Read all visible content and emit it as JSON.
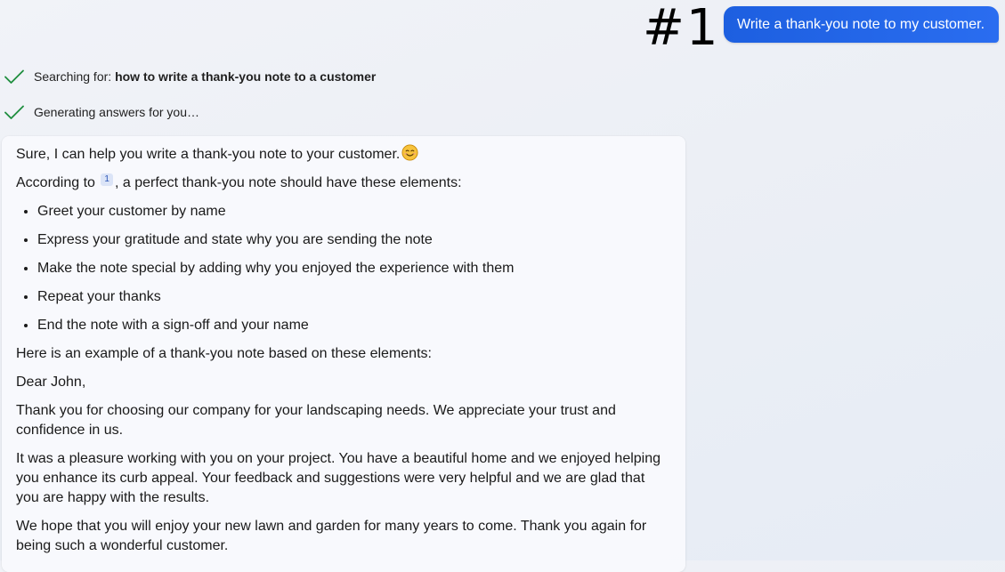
{
  "overlay_label": "#1",
  "user_message": "Write a thank-you note to my customer.",
  "status": {
    "searching_prefix": "Searching for: ",
    "searching_query": "how to write a thank-you note to a customer",
    "generating": "Generating answers for you…"
  },
  "answer": {
    "intro": "Sure, I can help you write a thank-you note to your customer.",
    "intro_emoji": "smiling-face-icon",
    "according_prefix": "According to ",
    "citation": "1",
    "according_suffix": ", a perfect thank-you note should have these elements:",
    "elements": [
      "Greet your customer by name",
      "Express your gratitude and state why you are sending the note",
      "Make the note special by adding why you enjoyed the experience with them",
      "Repeat your thanks",
      "End the note with a sign-off and your name"
    ],
    "example_intro": "Here is an example of a thank-you note based on these elements:",
    "greeting": "Dear John,",
    "paragraphs": [
      "Thank you for choosing our company for your landscaping needs. We appreciate your trust and confidence in us.",
      "It was a pleasure working with you on your project. You have a beautiful home and we enjoyed helping you enhance its curb appeal. Your feedback and suggestions were very helpful and we are glad that you are happy with the results.",
      "We hope that you will enjoy your new lawn and garden for many years to come. Thank you again for being such a wonderful customer."
    ]
  },
  "colors": {
    "user_bubble": "#1d5fe0",
    "check_green": "#1e8e3e",
    "citation_bg": "#dbe4f7"
  }
}
